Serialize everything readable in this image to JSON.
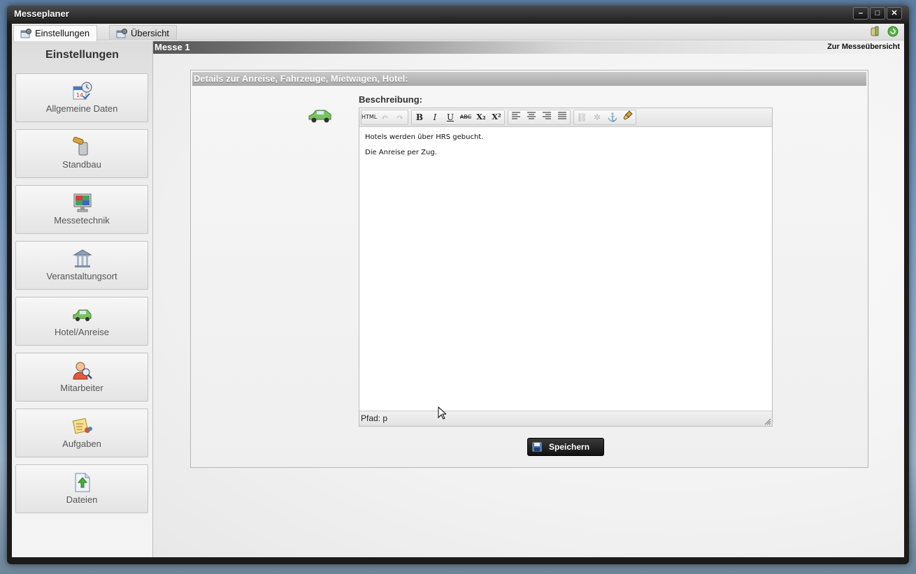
{
  "window": {
    "title": "Messeplaner"
  },
  "window_controls": {
    "minimize": "–",
    "maximize": "□",
    "close": "✕"
  },
  "tabs": [
    {
      "label": "Einstellungen",
      "active": true,
      "icon": "settings-tab-icon"
    },
    {
      "label": "Übersicht",
      "active": false,
      "icon": "overview-tab-icon"
    }
  ],
  "sidebar": {
    "title": "Einstellungen",
    "items": [
      {
        "label": "Allgemeine Daten",
        "icon": "calendar-clock-icon"
      },
      {
        "label": "Standbau",
        "icon": "hammer-icon"
      },
      {
        "label": "Messetechnik",
        "icon": "monitor-icon"
      },
      {
        "label": "Veranstaltungsort",
        "icon": "building-icon"
      },
      {
        "label": "Hotel/Anreise",
        "icon": "car-icon"
      },
      {
        "label": "Mitarbeiter",
        "icon": "user-search-icon"
      },
      {
        "label": "Aufgaben",
        "icon": "tasks-icon"
      },
      {
        "label": "Dateien",
        "icon": "file-upload-icon"
      }
    ]
  },
  "main": {
    "messe_title": "Messe 1",
    "back_link": "Zur Messeübersicht",
    "panel_title": "Details zur Anreise, Fahrzeuge, Mietwagen, Hotel:",
    "description_label": "Beschreibung:",
    "editor": {
      "toolbar": {
        "html": "HTML",
        "bold": "B",
        "italic": "I",
        "underline": "U",
        "strike": "ABC",
        "subscript": "X₂",
        "superscript": "X²"
      },
      "lines": [
        "Hotels werden über HRS gebucht.",
        "Die Anreise per Zug."
      ],
      "path_label": "Pfad: p"
    },
    "save_label": "Speichern"
  },
  "colors": {
    "accent": "#5cb85c",
    "dark_button": "#1e1e1e",
    "header_gray": "#b0b0b0"
  }
}
